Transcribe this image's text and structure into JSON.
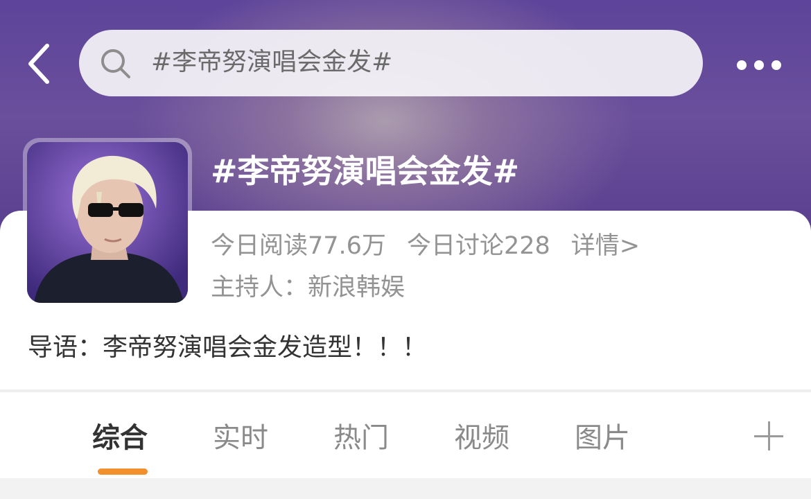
{
  "header": {
    "search_text": "#李帝努演唱会金发#",
    "back_icon": "chevron-left-icon",
    "more_icon": "more-dots-icon",
    "search_icon": "search-icon"
  },
  "topic": {
    "title": "#李帝努演唱会金发#",
    "read_today": "今日阅读77.6万",
    "discuss_today": "今日讨论228",
    "details_link": "详情>",
    "host": "主持人：新浪韩娱",
    "intro": "导语：李帝努演唱会金发造型！！！"
  },
  "tabs": [
    {
      "label": "综合",
      "active": true
    },
    {
      "label": "实时",
      "active": false
    },
    {
      "label": "热门",
      "active": false
    },
    {
      "label": "视频",
      "active": false
    },
    {
      "label": "图片",
      "active": false
    }
  ],
  "colors": {
    "accent": "#f1902d",
    "hero_purple": "#5e449a"
  }
}
